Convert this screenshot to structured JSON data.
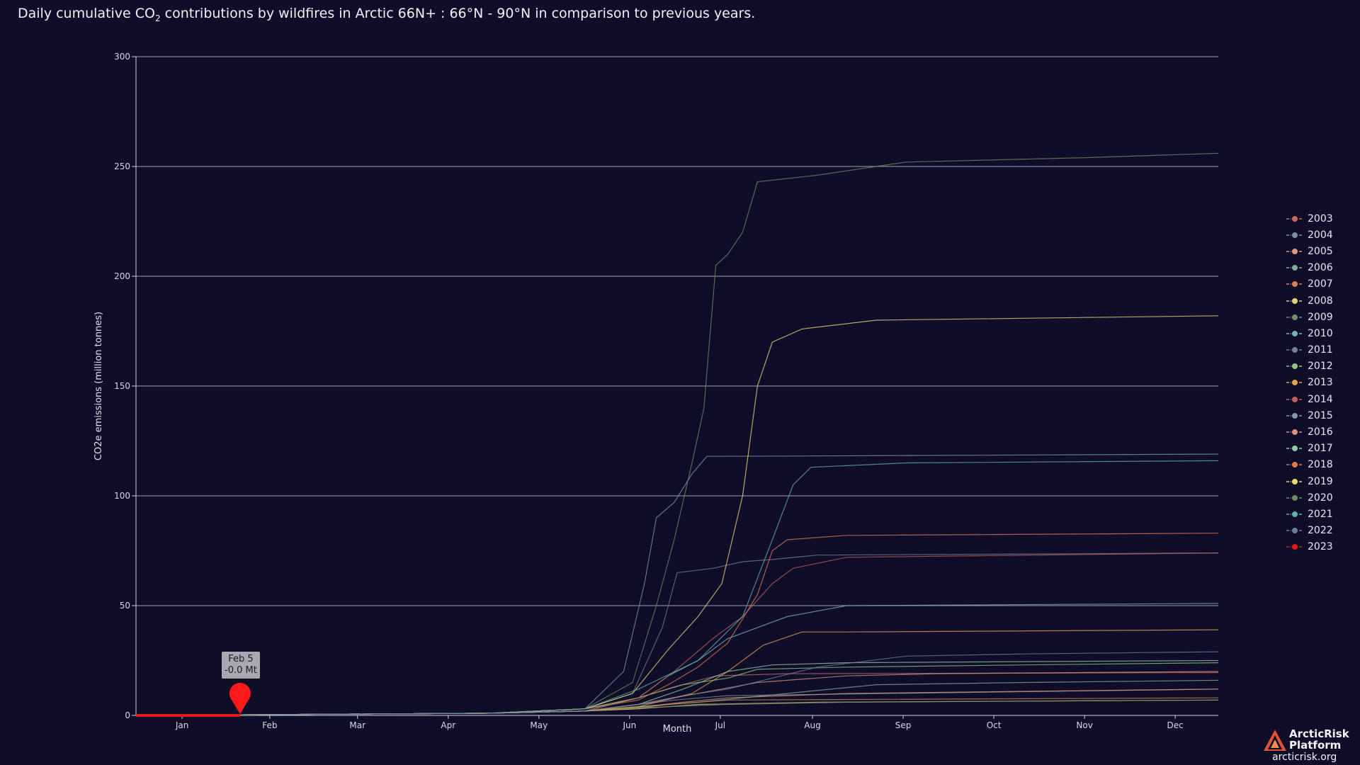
{
  "title": {
    "prefix": "Daily cumulative CO",
    "subscript": "2",
    "suffix": " contributions by wildfires in Arctic 66N+ : 66°N - 90°N in comparison to previous years."
  },
  "chart_data": {
    "type": "line",
    "xlabel": "Month",
    "ylabel": "CO2e emissions (million tonnes)",
    "ylim": [
      0,
      300
    ],
    "yticks": [
      0,
      50,
      100,
      150,
      200,
      250,
      300
    ],
    "grid": true,
    "legend_position": "right",
    "x_tick_labels": [
      "Jan",
      "Feb",
      "Mar",
      "Apr",
      "May",
      "Jun",
      "Jul",
      "Aug",
      "Sep",
      "Oct",
      "Nov",
      "Dec"
    ],
    "series": [
      {
        "name": "2003",
        "color": "#c56b63",
        "points": [
          [
            1,
            0
          ],
          [
            120,
            1
          ],
          [
            152,
            3
          ],
          [
            170,
            8
          ],
          [
            182,
            13
          ],
          [
            196,
            18
          ],
          [
            220,
            19
          ],
          [
            365,
            19.5
          ]
        ]
      },
      {
        "name": "2004",
        "color": "#7f9097",
        "points": [
          [
            1,
            0
          ],
          [
            120,
            1
          ],
          [
            152,
            2
          ],
          [
            170,
            5
          ],
          [
            182,
            7
          ],
          [
            200,
            9
          ],
          [
            365,
            12
          ]
        ]
      },
      {
        "name": "2005",
        "color": "#d99a7a",
        "points": [
          [
            1,
            0
          ],
          [
            120,
            1
          ],
          [
            152,
            2
          ],
          [
            172,
            4
          ],
          [
            185,
            6
          ],
          [
            200,
            8
          ],
          [
            240,
            10
          ],
          [
            365,
            12
          ]
        ]
      },
      {
        "name": "2006",
        "color": "#7fae9c",
        "points": [
          [
            1,
            0
          ],
          [
            120,
            1
          ],
          [
            152,
            2
          ],
          [
            170,
            4
          ],
          [
            190,
            6
          ],
          [
            220,
            10
          ],
          [
            250,
            14
          ],
          [
            300,
            15
          ],
          [
            365,
            16
          ]
        ]
      },
      {
        "name": "2007",
        "color": "#d7805f",
        "points": [
          [
            1,
            0
          ],
          [
            120,
            1
          ],
          [
            152,
            2
          ],
          [
            168,
            3
          ],
          [
            180,
            5
          ],
          [
            200,
            7
          ],
          [
            365,
            8
          ]
        ]
      },
      {
        "name": "2008",
        "color": "#e3d27b",
        "points": [
          [
            1,
            0
          ],
          [
            120,
            1
          ],
          [
            152,
            2
          ],
          [
            170,
            3
          ],
          [
            190,
            5
          ],
          [
            230,
            6
          ],
          [
            365,
            7
          ]
        ]
      },
      {
        "name": "2009",
        "color": "#6f8f6a",
        "points": [
          [
            1,
            0
          ],
          [
            120,
            1
          ],
          [
            152,
            2
          ],
          [
            165,
            3
          ],
          [
            180,
            4
          ],
          [
            200,
            5
          ],
          [
            240,
            6
          ],
          [
            365,
            7
          ]
        ]
      },
      {
        "name": "2010",
        "color": "#6fb8b0",
        "points": [
          [
            1,
            0
          ],
          [
            120,
            1
          ],
          [
            152,
            2
          ],
          [
            170,
            8
          ],
          [
            180,
            18
          ],
          [
            190,
            25
          ],
          [
            200,
            35
          ],
          [
            220,
            45
          ],
          [
            240,
            50
          ],
          [
            365,
            51
          ]
        ]
      },
      {
        "name": "2011",
        "color": "#6e8296",
        "points": [
          [
            1,
            0
          ],
          [
            120,
            1
          ],
          [
            152,
            3
          ],
          [
            168,
            10
          ],
          [
            178,
            40
          ],
          [
            183,
            65
          ],
          [
            195,
            67
          ],
          [
            205,
            70
          ],
          [
            215,
            71
          ],
          [
            230,
            73
          ],
          [
            365,
            74
          ]
        ]
      },
      {
        "name": "2012",
        "color": "#8fc781",
        "points": [
          [
            1,
            0
          ],
          [
            120,
            1
          ],
          [
            152,
            3
          ],
          [
            170,
            8
          ],
          [
            185,
            14
          ],
          [
            200,
            17
          ],
          [
            210,
            21
          ],
          [
            240,
            22
          ],
          [
            300,
            23
          ],
          [
            365,
            24
          ]
        ]
      },
      {
        "name": "2013",
        "color": "#e8a44a",
        "points": [
          [
            1,
            0
          ],
          [
            120,
            1
          ],
          [
            152,
            2
          ],
          [
            170,
            4
          ],
          [
            188,
            10
          ],
          [
            200,
            20
          ],
          [
            212,
            32
          ],
          [
            225,
            38
          ],
          [
            240,
            38
          ],
          [
            365,
            39
          ]
        ]
      },
      {
        "name": "2014",
        "color": "#c0605b",
        "points": [
          [
            1,
            0
          ],
          [
            120,
            1
          ],
          [
            152,
            2
          ],
          [
            170,
            8
          ],
          [
            182,
            20
          ],
          [
            195,
            35
          ],
          [
            205,
            45
          ],
          [
            215,
            60
          ],
          [
            222,
            67
          ],
          [
            240,
            72
          ],
          [
            365,
            74
          ]
        ]
      },
      {
        "name": "2015",
        "color": "#7e98a6",
        "points": [
          [
            1,
            0
          ],
          [
            120,
            1
          ],
          [
            152,
            3
          ],
          [
            165,
            20
          ],
          [
            172,
            60
          ],
          [
            176,
            90
          ],
          [
            182,
            97
          ],
          [
            188,
            110
          ],
          [
            193,
            118
          ],
          [
            200,
            118
          ],
          [
            365,
            119
          ]
        ]
      },
      {
        "name": "2016",
        "color": "#d89480",
        "points": [
          [
            1,
            0
          ],
          [
            120,
            1
          ],
          [
            152,
            2
          ],
          [
            170,
            5
          ],
          [
            190,
            10
          ],
          [
            210,
            15
          ],
          [
            240,
            18
          ],
          [
            270,
            19
          ],
          [
            365,
            20
          ]
        ]
      },
      {
        "name": "2017",
        "color": "#8ec9a8",
        "points": [
          [
            1,
            0
          ],
          [
            120,
            1
          ],
          [
            152,
            2
          ],
          [
            170,
            5
          ],
          [
            185,
            12
          ],
          [
            200,
            20
          ],
          [
            215,
            23
          ],
          [
            240,
            24
          ],
          [
            365,
            25
          ]
        ]
      },
      {
        "name": "2018",
        "color": "#e07a4f",
        "points": [
          [
            1,
            0
          ],
          [
            120,
            1
          ],
          [
            152,
            3
          ],
          [
            170,
            7
          ],
          [
            180,
            14
          ],
          [
            190,
            22
          ],
          [
            200,
            33
          ],
          [
            210,
            55
          ],
          [
            215,
            75
          ],
          [
            220,
            80
          ],
          [
            240,
            82
          ],
          [
            365,
            83
          ]
        ]
      },
      {
        "name": "2019",
        "color": "#ecd874",
        "points": [
          [
            1,
            0
          ],
          [
            120,
            1
          ],
          [
            152,
            3
          ],
          [
            168,
            10
          ],
          [
            180,
            30
          ],
          [
            190,
            45
          ],
          [
            198,
            60
          ],
          [
            205,
            100
          ],
          [
            210,
            150
          ],
          [
            215,
            170
          ],
          [
            225,
            176
          ],
          [
            250,
            180
          ],
          [
            365,
            182
          ]
        ]
      },
      {
        "name": "2020",
        "color": "#6a8f62",
        "points": [
          [
            1,
            0
          ],
          [
            120,
            1
          ],
          [
            152,
            3
          ],
          [
            168,
            15
          ],
          [
            176,
            50
          ],
          [
            182,
            80
          ],
          [
            188,
            115
          ],
          [
            192,
            140
          ],
          [
            196,
            205
          ],
          [
            200,
            210
          ],
          [
            205,
            220
          ],
          [
            210,
            243
          ],
          [
            230,
            246
          ],
          [
            260,
            252
          ],
          [
            320,
            254
          ],
          [
            365,
            256
          ]
        ]
      },
      {
        "name": "2021",
        "color": "#5fb1ab",
        "points": [
          [
            1,
            0
          ],
          [
            120,
            1
          ],
          [
            152,
            3
          ],
          [
            170,
            12
          ],
          [
            190,
            25
          ],
          [
            205,
            45
          ],
          [
            215,
            80
          ],
          [
            222,
            105
          ],
          [
            228,
            113
          ],
          [
            260,
            115
          ],
          [
            365,
            116
          ]
        ]
      },
      {
        "name": "2022",
        "color": "#6d7f99",
        "points": [
          [
            1,
            0
          ],
          [
            120,
            1
          ],
          [
            152,
            2
          ],
          [
            170,
            5
          ],
          [
            185,
            9
          ],
          [
            200,
            12
          ],
          [
            230,
            22
          ],
          [
            260,
            27
          ],
          [
            300,
            28
          ],
          [
            365,
            29
          ]
        ]
      },
      {
        "name": "2023",
        "color": "#e0191c",
        "points": [
          [
            1,
            0
          ],
          [
            36,
            0
          ]
        ]
      }
    ]
  },
  "marker": {
    "date": "Feb 5",
    "value": "-0.0 Mt",
    "color": "#ff1a1a"
  },
  "logo": {
    "name_line1": "ArcticRisk",
    "name_line2": "Platform",
    "url": "arcticrisk.org"
  }
}
